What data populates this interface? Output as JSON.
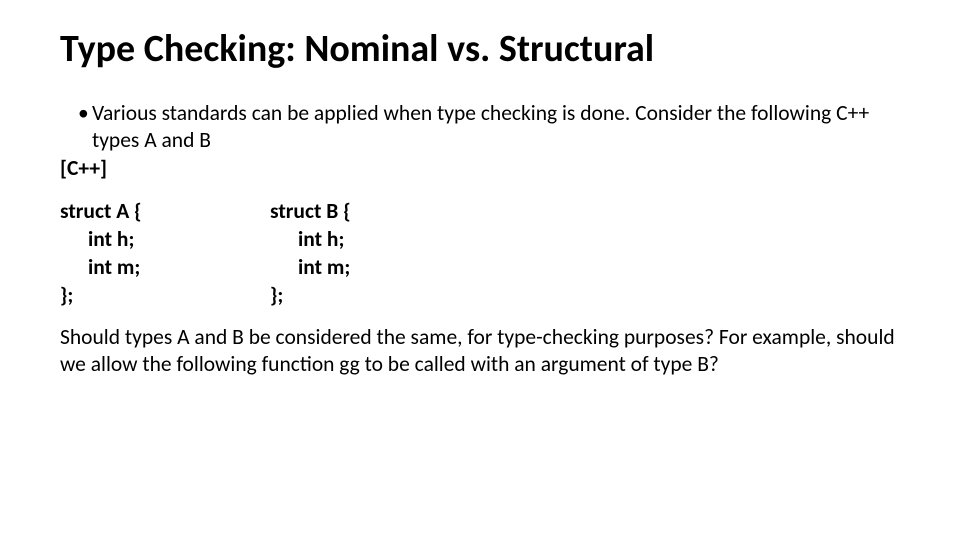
{
  "title": "Type Checking: Nominal vs. Structural",
  "bullet1": "Various standards can be applied when type checking is done. Consider the following C++ types A and B",
  "langLabel": "[C++]",
  "code": {
    "a": {
      "l1": "struct A {",
      "l2": "int h;",
      "l3": "int m;",
      "l4": "};"
    },
    "b": {
      "l1": "struct B {",
      "l2": "int h;",
      "l3": "int m;",
      "l4": "};"
    }
  },
  "para": "Should types A and B be considered the same, for type-checking purposes? For example, should we allow the following function gg to be called with an argument of type B?"
}
